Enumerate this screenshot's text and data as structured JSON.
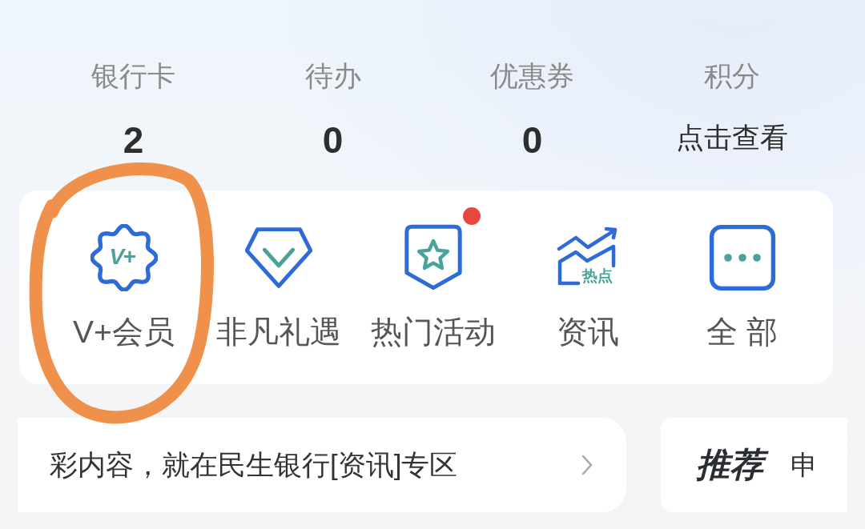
{
  "stats": [
    {
      "label": "银行卡",
      "value": "2",
      "kind": "count"
    },
    {
      "label": "待办",
      "value": "0",
      "kind": "count"
    },
    {
      "label": "优惠券",
      "value": "0",
      "kind": "count"
    },
    {
      "label": "积分",
      "value": "点击查看",
      "kind": "link"
    }
  ],
  "shortcuts": [
    {
      "label": "V+会员",
      "kind": "badge",
      "icon_text": "V+",
      "dot": false,
      "circled": true
    },
    {
      "label": "非凡礼遇",
      "kind": "gem",
      "dot": false,
      "circled": false
    },
    {
      "label": "热门活动",
      "kind": "shield",
      "dot": true,
      "circled": false
    },
    {
      "label": "资讯",
      "kind": "trend",
      "icon_text": "热点",
      "dot": false,
      "circled": false
    },
    {
      "label": "全 部",
      "kind": "more",
      "dot": false,
      "circled": false
    }
  ],
  "news": {
    "text": "彩内容，就在民生银行[资讯]专区"
  },
  "recommend": {
    "tag": "推荐",
    "text": "申"
  }
}
